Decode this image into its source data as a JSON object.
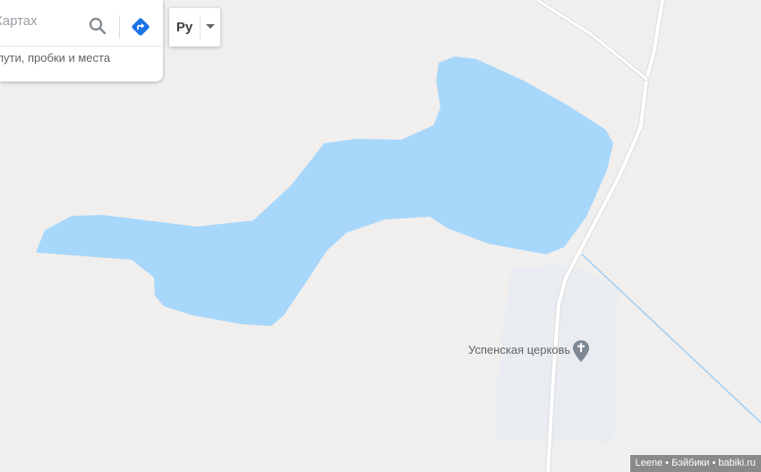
{
  "search": {
    "placeholder": "Картах",
    "hint": "пути, пробки и места",
    "search_icon": "search-icon",
    "directions_icon": "directions-icon"
  },
  "currency": {
    "label": "Ру",
    "dropdown_icon": "caret-down-icon"
  },
  "map": {
    "colors": {
      "land": "#f1efed",
      "water": "#a8d7fc",
      "road": "#ffffff",
      "road_edge": "#dcdcdc",
      "church_area": "#e9ecf0",
      "stream": "#9ccdf5",
      "pin": "#7e8794"
    },
    "poi": {
      "name": "Успенская церковь",
      "icon": "church-pin-icon"
    }
  },
  "attribution": "Leene • Бэйбики • babiki.ru"
}
